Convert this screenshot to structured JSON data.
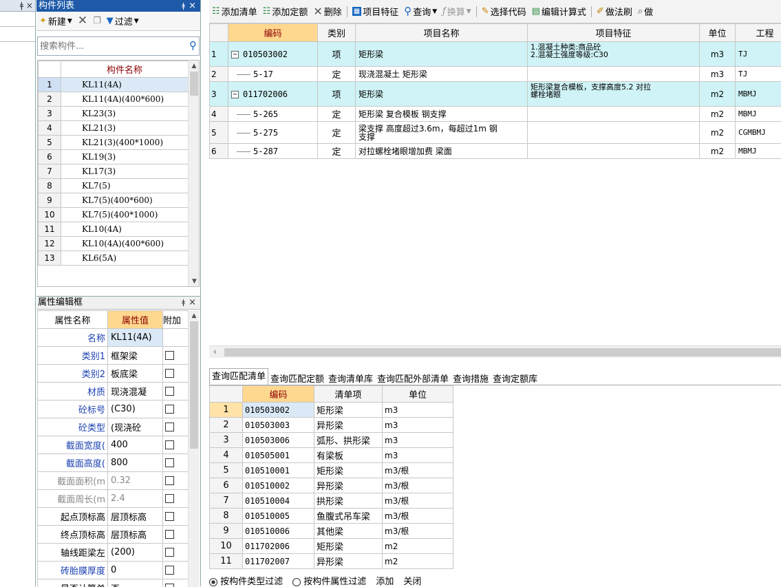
{
  "left_strip": {
    "close_glyph": "ǂ ×"
  },
  "component_list": {
    "title": "构件列表",
    "pin": "ǂ",
    "close": "×",
    "toolbar": {
      "new_label": "新建",
      "filter_label": "过滤"
    },
    "search_placeholder": "搜索构件...",
    "column_header": "构件名称",
    "rows": [
      {
        "n": "1",
        "name": "KL11(4A)"
      },
      {
        "n": "2",
        "name": "KL11(4A)(400*600)"
      },
      {
        "n": "3",
        "name": "KL23(3)"
      },
      {
        "n": "4",
        "name": "KL21(3)"
      },
      {
        "n": "5",
        "name": "KL21(3)(400*1000)"
      },
      {
        "n": "6",
        "name": "KL19(3)"
      },
      {
        "n": "7",
        "name": "KL17(3)"
      },
      {
        "n": "8",
        "name": "KL7(5)"
      },
      {
        "n": "9",
        "name": "KL7(5)(400*600)"
      },
      {
        "n": "10",
        "name": "KL7(5)(400*1000)"
      },
      {
        "n": "11",
        "name": "KL10(4A)"
      },
      {
        "n": "12",
        "name": "KL10(4A)(400*600)"
      },
      {
        "n": "13",
        "name": "KL6(5A)"
      }
    ]
  },
  "property_editor": {
    "title": "属性编辑框",
    "pin": "ǂ",
    "close": "×",
    "headers": {
      "name": "属性名称",
      "value": "属性值",
      "extra": "附加"
    },
    "rows": [
      {
        "k": "名称",
        "v": "KL11(4A)",
        "blue": true,
        "gray": false,
        "chk": false
      },
      {
        "k": "类别1",
        "v": "框架梁",
        "blue": true,
        "gray": false,
        "chk": true
      },
      {
        "k": "类别2",
        "v": "板底梁",
        "blue": true,
        "gray": false,
        "chk": true
      },
      {
        "k": "材质",
        "v": "现浇混凝",
        "blue": true,
        "gray": false,
        "chk": true
      },
      {
        "k": "砼标号",
        "v": "(C30)",
        "blue": true,
        "gray": false,
        "chk": true
      },
      {
        "k": "砼类型",
        "v": "(现浇砼",
        "blue": true,
        "gray": false,
        "chk": true
      },
      {
        "k": "截面宽度(",
        "v": "400",
        "blue": true,
        "gray": false,
        "chk": true
      },
      {
        "k": "截面高度(",
        "v": "800",
        "blue": true,
        "gray": false,
        "chk": true
      },
      {
        "k": "截面面积(m",
        "v": "0.32",
        "blue": false,
        "gray": true,
        "chk": true
      },
      {
        "k": "截面周长(m",
        "v": "2.4",
        "blue": false,
        "gray": true,
        "chk": true
      },
      {
        "k": "起点顶标高",
        "v": "层顶标高",
        "blue": false,
        "gray": false,
        "chk": true
      },
      {
        "k": "终点顶标高",
        "v": "层顶标高",
        "blue": false,
        "gray": false,
        "chk": true
      },
      {
        "k": "轴线距梁左",
        "v": "(200)",
        "blue": false,
        "gray": false,
        "chk": true
      },
      {
        "k": "砖胎膜厚度",
        "v": "0",
        "blue": true,
        "gray": false,
        "chk": true
      },
      {
        "k": "是否计算单",
        "v": "否",
        "blue": false,
        "gray": false,
        "chk": true
      }
    ]
  },
  "main_toolbar": {
    "add_list": "添加清单",
    "add_quota": "添加定额",
    "delete": "删除",
    "item_feature": "项目特征",
    "query": "查询",
    "convert": "换算",
    "select_code": "选择代码",
    "edit_formula": "编辑计算式",
    "method_brush": "做法刷",
    "method_query": "做"
  },
  "main_grid": {
    "headers": {
      "code": "编码",
      "type": "类别",
      "name": "项目名称",
      "feature": "项目特征",
      "unit": "单位",
      "qty": "工程"
    },
    "rows": [
      {
        "n": "1",
        "code": "010503002",
        "type": "项",
        "name": "矩形梁",
        "feature": "1.混凝土种类:商品砼\n2.混凝土强度等级:C30",
        "unit": "m3",
        "qty": "TJ",
        "top": true,
        "cyan": true
      },
      {
        "n": "2",
        "code": "5-17",
        "type": "定",
        "name": "现浇混凝土 矩形梁",
        "feature": "",
        "unit": "m3",
        "qty": "TJ",
        "top": false,
        "cyan": false
      },
      {
        "n": "3",
        "code": "011702006",
        "type": "项",
        "name": "矩形梁",
        "feature": "矩形梁复合模板，支撑高度5.2 对拉\n螺栓堵眼",
        "unit": "m2",
        "qty": "MBMJ",
        "top": true,
        "cyan": true
      },
      {
        "n": "4",
        "code": "5-265",
        "type": "定",
        "name": "矩形梁 复合模板 钢支撑",
        "feature": "",
        "unit": "m2",
        "qty": "MBMJ",
        "top": false,
        "cyan": false
      },
      {
        "n": "5",
        "code": "5-275",
        "type": "定",
        "name": "梁支撑 高度超过3.6m，每超过1m 钢\n支撑",
        "feature": "",
        "unit": "m2",
        "qty": "CGMBMJ",
        "top": false,
        "cyan": false
      },
      {
        "n": "6",
        "code": "5-287",
        "type": "定",
        "name": "对拉螺栓堵眼增加费 梁面",
        "feature": "",
        "unit": "m2",
        "qty": "MBMJ",
        "top": false,
        "cyan": false
      }
    ]
  },
  "bottom_tabs": [
    "查询匹配清单",
    "查询匹配定额",
    "查询清单库",
    "查询匹配外部清单",
    "查询措施",
    "查询定额库"
  ],
  "query_grid": {
    "headers": {
      "code": "编码",
      "item": "清单项",
      "unit": "单位"
    },
    "rows": [
      {
        "n": "1",
        "code": "010503002",
        "item": "矩形梁",
        "unit": "m3"
      },
      {
        "n": "2",
        "code": "010503003",
        "item": "异形梁",
        "unit": "m3"
      },
      {
        "n": "3",
        "code": "010503006",
        "item": "弧形、拱形梁",
        "unit": "m3"
      },
      {
        "n": "4",
        "code": "010505001",
        "item": "有梁板",
        "unit": "m3"
      },
      {
        "n": "5",
        "code": "010510001",
        "item": "矩形梁",
        "unit": "m3/根"
      },
      {
        "n": "6",
        "code": "010510002",
        "item": "异形梁",
        "unit": "m3/根"
      },
      {
        "n": "7",
        "code": "010510004",
        "item": "拱形梁",
        "unit": "m3/根"
      },
      {
        "n": "8",
        "code": "010510005",
        "item": "鱼腹式吊车梁",
        "unit": "m3/根"
      },
      {
        "n": "9",
        "code": "010510006",
        "item": "其他梁",
        "unit": "m3/根"
      },
      {
        "n": "10",
        "code": "011702006",
        "item": "矩形梁",
        "unit": "m2"
      },
      {
        "n": "11",
        "code": "011702007",
        "item": "异形梁",
        "unit": "m2"
      }
    ]
  },
  "filter_bar": {
    "by_type": "按构件类型过滤",
    "by_attr": "按构件属性过滤",
    "add": "添加",
    "close": "关闭"
  }
}
